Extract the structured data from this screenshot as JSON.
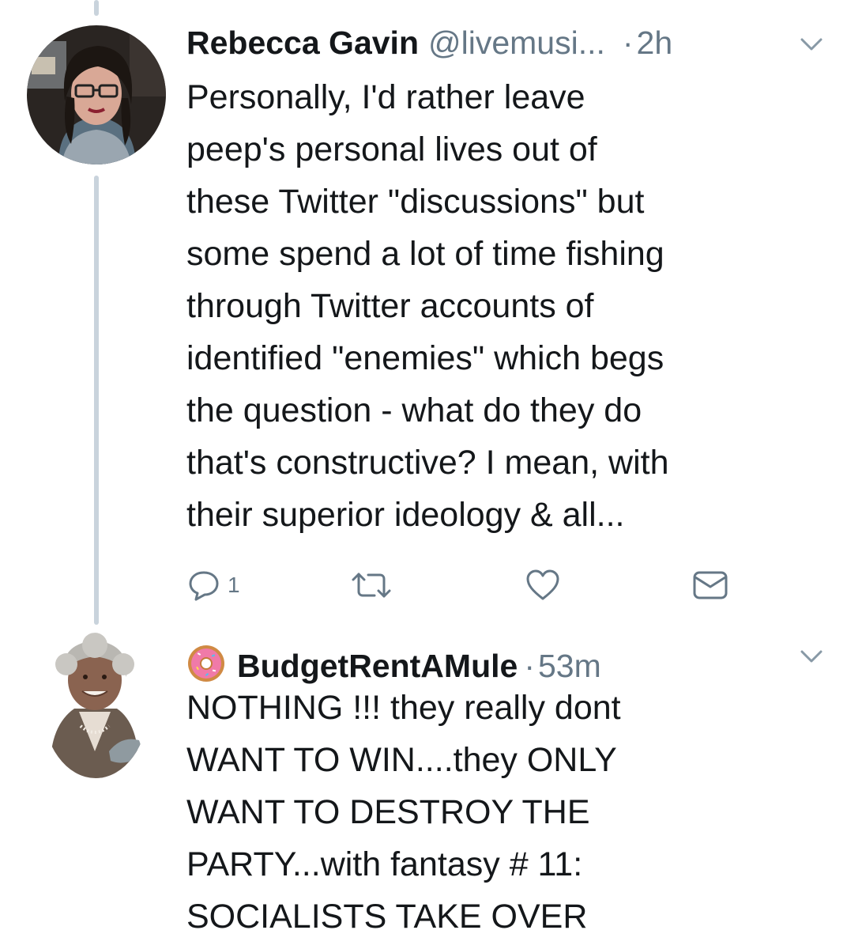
{
  "tweets": [
    {
      "author_name": "Rebecca Gavin",
      "handle": "@livemusi...",
      "separator": "·",
      "time": "2h",
      "text_lines": [
        "Personally, I'd rather leave",
        "peep's personal lives out of",
        "these Twitter \"discussions\" but",
        "some spend a lot of time fishing",
        "through Twitter accounts of",
        "identified \"enemies\" which begs",
        "the question - what do they do",
        "that's constructive? I mean, with",
        "their superior ideology & all..."
      ],
      "actions": {
        "reply_count": "1",
        "icons": [
          "reply-icon",
          "retweet-icon",
          "like-icon",
          "direct-message-icon"
        ]
      }
    },
    {
      "author_name": "BudgetRentAMule",
      "name_emoji": "donut-emoji",
      "separator": "·",
      "time": "53m",
      "text_lines": [
        "NOTHING !!! they really dont",
        "WANT TO WIN....they ONLY",
        "WANT TO DESTROY THE",
        "PARTY...with fantasy # 11:",
        "SOCIALISTS TAKE OVER"
      ]
    }
  ],
  "colors": {
    "text_primary": "#14171a",
    "text_secondary": "#657786",
    "thread_line": "#c9d3dc",
    "background": "#ffffff"
  }
}
